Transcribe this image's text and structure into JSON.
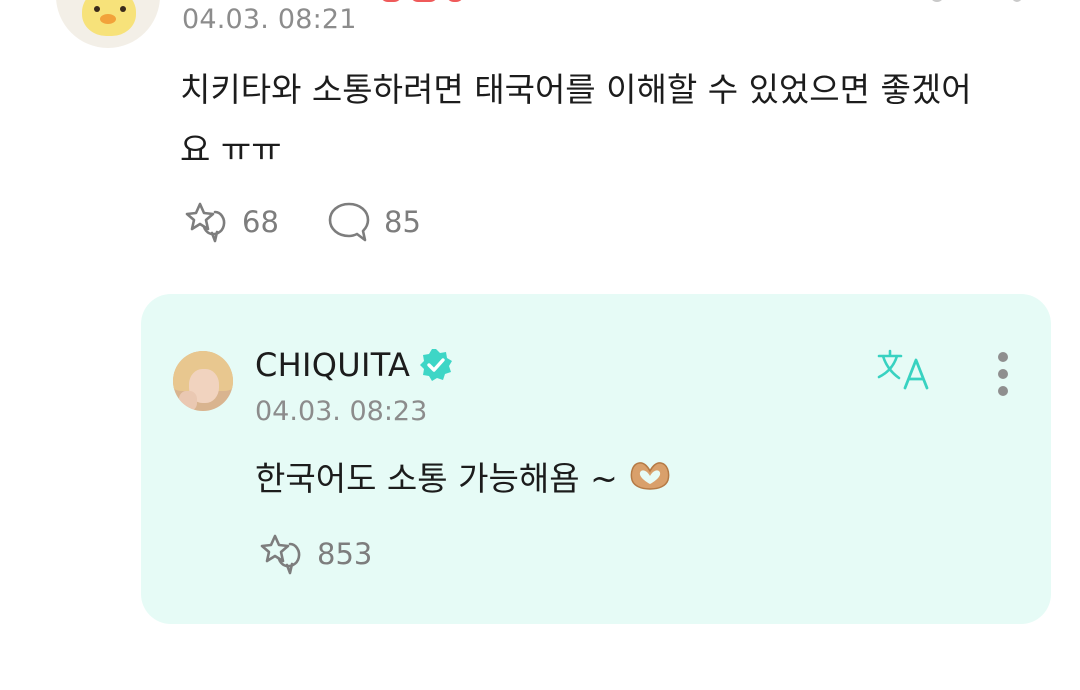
{
  "top_comment": {
    "date": "04.03. 08:21",
    "text": "치키타와 소통하려면 태국어를 이해할 수 있었으면 좋겠어요 ㅠㅠ",
    "likes": "68",
    "comments": "85"
  },
  "reply": {
    "author": "CHIQUITA",
    "verified": true,
    "date": "04.03. 08:23",
    "text": "한국어도 소통 가능해욤 ~",
    "emoji": "heart-hands",
    "likes": "853",
    "background_color": "#e6fbf6",
    "verified_color": "#3ed6c6",
    "translate_icon_color": "#38d2c1"
  },
  "colors": {
    "muted_text": "#8c8c8c",
    "icon_gray": "#7d7d7d"
  }
}
